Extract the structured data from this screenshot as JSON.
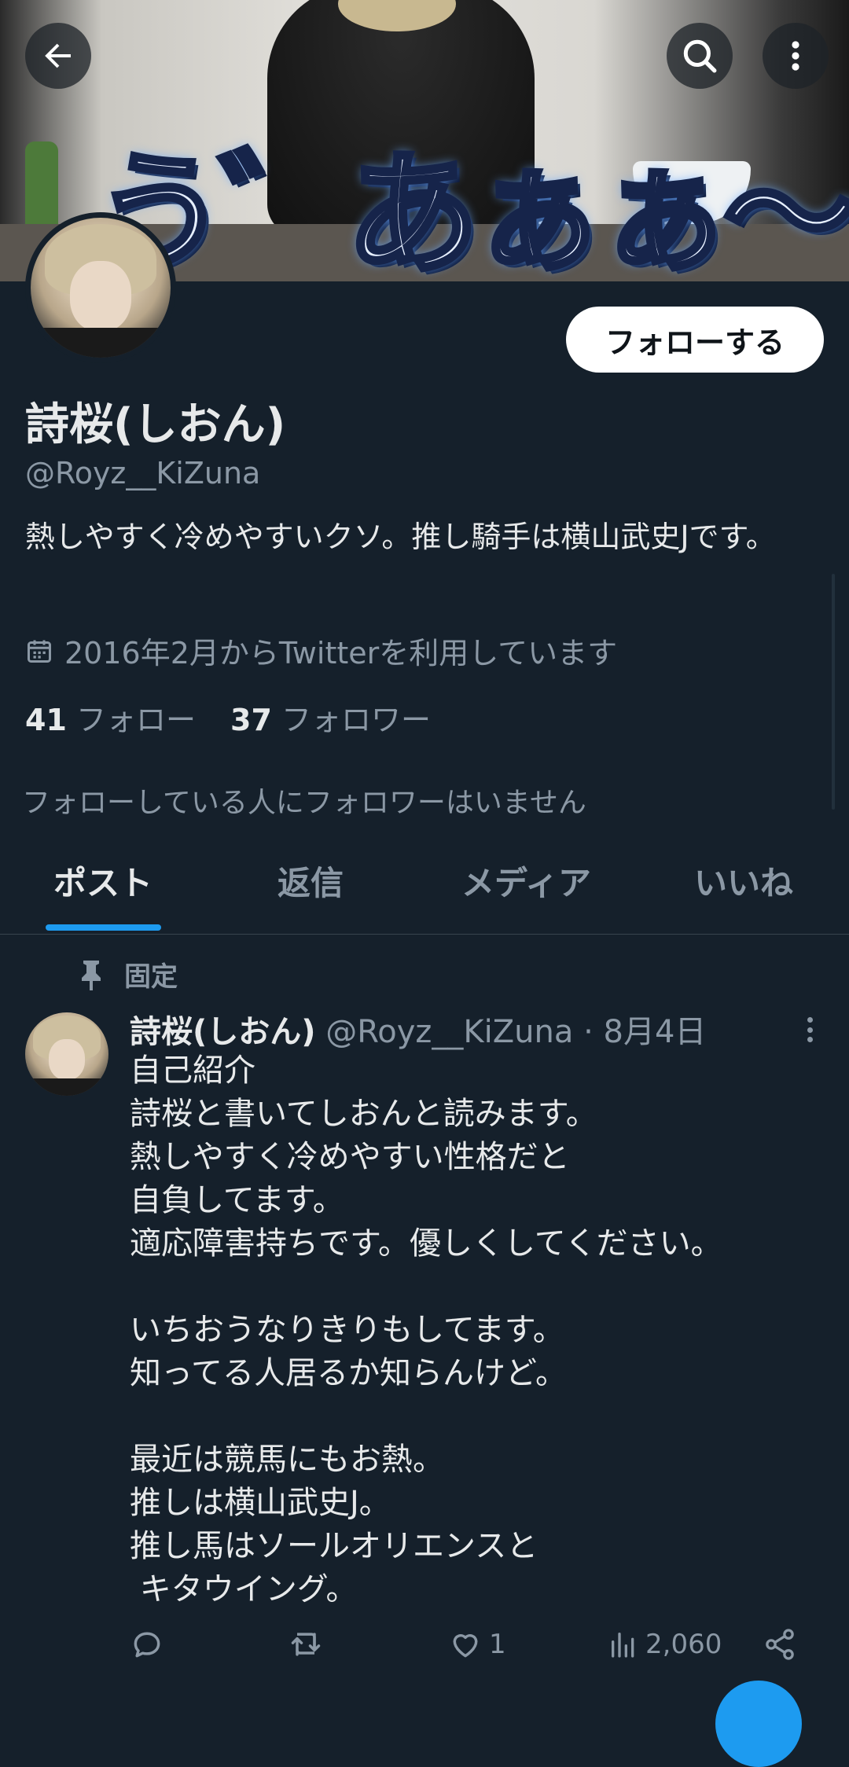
{
  "banner": {
    "caption": "う゛あぁぁ〜"
  },
  "profile": {
    "follow_label": "フォローする",
    "display_name": "詩桜(しおん)",
    "handle": "@Royz__KiZuna",
    "bio": "熱しやすく冷めやすいクソ。推し騎手は横山武史Jです。",
    "joined": "2016年2月からTwitterを利用しています",
    "following_count": "41",
    "following_label": "フォロー",
    "followers_count": "37",
    "followers_label": "フォロワー",
    "mutual_note": "フォローしている人にフォロワーはいません"
  },
  "tabs": [
    {
      "label": "ポスト",
      "active": true
    },
    {
      "label": "返信"
    },
    {
      "label": "メディア"
    },
    {
      "label": "いいね"
    }
  ],
  "post": {
    "pinned_label": "固定",
    "author_name": "詩桜(しおん)",
    "meta": "@Royz__KiZuna · 8月4日",
    "body": "自己紹介\n詩桜と書いてしおんと読みます。\n熱しやすく冷めやすい性格だと\n自負してます。\n適応障害持ちです。優しくしてください。\n\nいちおうなりきりもしてます。\n知ってる人居るか知らんけど。\n\n最近は競馬にもお熱。\n推しは横山武史J。\n推し馬はソールオリエンスと\n キタウイング。",
    "likes": "1",
    "views": "2,060"
  },
  "colors": {
    "background": "#15202b",
    "accent": "#1d9bf0",
    "muted": "#8b98a5",
    "text": "#e7e9ea"
  }
}
